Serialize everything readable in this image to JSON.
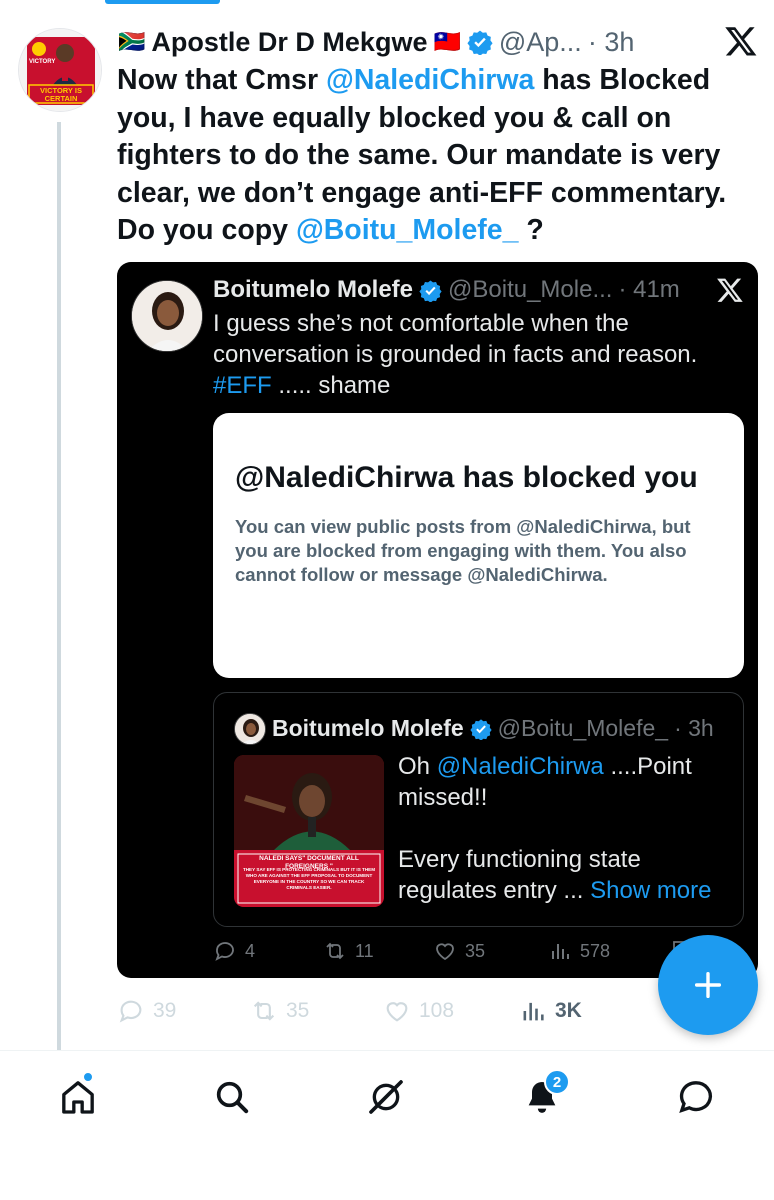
{
  "tweet": {
    "flag_left": "🇿🇦",
    "name": "Apostle Dr D Mekgwe",
    "flag_right": "🇹🇼",
    "handle": "@Ap...",
    "time": "· 3h",
    "text_1": "Now that Cmsr ",
    "mention_1": "@NalediChirwa",
    "text_2": " has Blocked you, I have equally blocked you & call on fighters to do the same. Our mandate is very clear, we don’t engage anti-EFF commentary. Do you copy ",
    "mention_2": "@Boitu_Molefe_",
    "text_3": " ?",
    "avatar_banner_text": "VICTORY IS CERTAIN",
    "avatar_top_text": "VICTORY",
    "replies": "39",
    "reposts": "35",
    "likes": "108",
    "views": "3K"
  },
  "quote": {
    "name": "Boitumelo Molefe",
    "handle": "@Boitu_Mole...",
    "time": "· 41m",
    "text_1": "I guess she’s not comfortable when the conversation is grounded in facts and reason.",
    "hashtag": "#EFF",
    "text_2": " ..... shame",
    "blocked_title": "@NalediChirwa has blocked you",
    "blocked_desc": "You can view public posts from @NalediChirwa, but you are blocked from engaging with them. You also cannot follow or message @NalediChirwa.",
    "replies": "4",
    "reposts": "11",
    "likes": "35",
    "views": "578"
  },
  "nested": {
    "name": "Boitumelo Molefe",
    "handle": "@Boitu_Molefe_",
    "time": "· 3h",
    "text_1": "Oh ",
    "mention": "@NalediChirwa",
    "text_2": " ....Point missed!!",
    "text_3": "Every functioning state regulates entry ...",
    "show_more": "Show more",
    "image_caption": "NALEDI SAYS\" DOCUMENT ALL FOREIGNERS \"",
    "image_subcaption": "THEY SAY EFF IS PROTECTING CRIMINALS BUT IT IS THEM WHO ARE AGAINST THE EFF PROPOSAL TO DOCUMENT EVERYONE IN THE COUNTRY SO WE CAN TRACK CRIMINALS EASIER."
  },
  "nav": {
    "notifications_badge": "2",
    "items": [
      "home-icon",
      "search-icon",
      "grok-icon",
      "notifications-icon",
      "messages-icon"
    ]
  },
  "colors": {
    "accent": "#1d9bf0",
    "quote_bg": "#000000",
    "muted": "#536471"
  }
}
